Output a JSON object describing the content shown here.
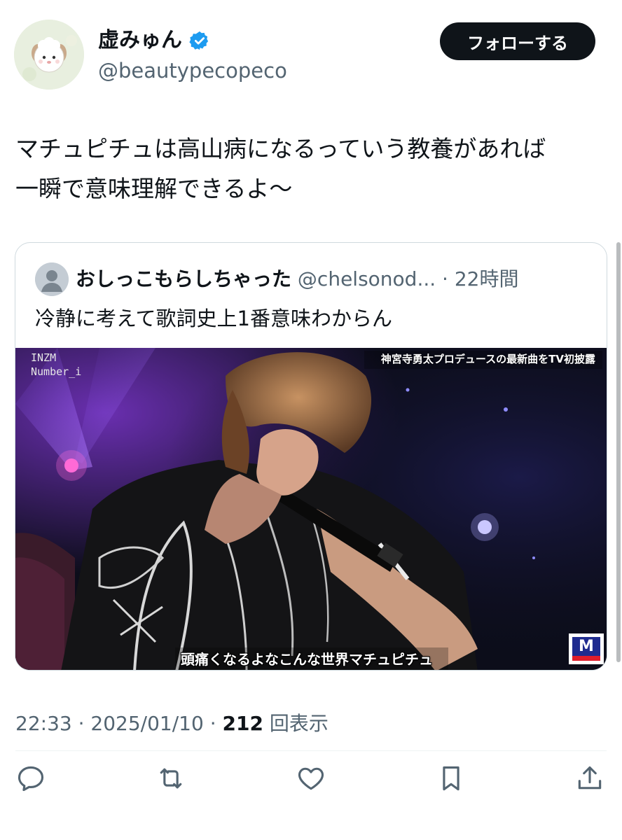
{
  "user": {
    "display_name": "虚みゅん",
    "handle": "@beautypecopeco",
    "verified": true,
    "avatar_icon": "sheep-avatar-icon"
  },
  "follow_button_label": "フォローする",
  "tweet_text": "マチュピチュは高山病になるっていう教養があれば\n一瞬で意味理解できるよ〜",
  "quote": {
    "display_name": "おしっこもらしちゃった",
    "handle": "@chelsonod...",
    "separator": "·",
    "time": "22時間",
    "text": "冷静に考えて歌詞史上1番意味わからん",
    "media": {
      "top_left_label_1": "INZM",
      "top_left_label_2": "Number_i",
      "top_right_caption": "神宮寺勇太プロデュースの最新曲をTV初披露",
      "subtitle": "頭痛くなるよなこんな世界マチュピチュ",
      "broadcast_logo": "M"
    }
  },
  "meta": {
    "time": "22:33",
    "separator": "·",
    "date": "2025/01/10",
    "views_count": "212",
    "views_label": "回表示"
  },
  "actions": [
    "reply-icon",
    "retweet-icon",
    "like-icon",
    "bookmark-icon",
    "share-icon"
  ],
  "colors": {
    "text_primary": "#0f1419",
    "text_secondary": "#536471",
    "verified_blue": "#1d9bf0",
    "border": "#cfd9de",
    "follow_bg": "#0f1419"
  }
}
